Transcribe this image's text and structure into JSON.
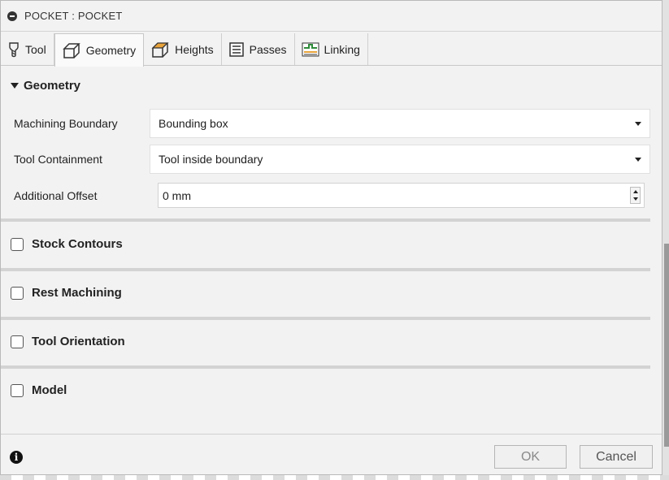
{
  "window": {
    "title": "POCKET : POCKET"
  },
  "tabs": [
    {
      "label": "Tool",
      "icon": "tool-icon",
      "active": false
    },
    {
      "label": "Geometry",
      "icon": "geometry-icon",
      "active": true
    },
    {
      "label": "Heights",
      "icon": "heights-icon",
      "active": false
    },
    {
      "label": "Passes",
      "icon": "passes-icon",
      "active": false
    },
    {
      "label": "Linking",
      "icon": "linking-icon",
      "active": false
    }
  ],
  "geometry": {
    "heading": "Geometry",
    "machining_boundary": {
      "label": "Machining Boundary",
      "value": "Bounding box"
    },
    "tool_containment": {
      "label": "Tool Containment",
      "value": "Tool inside boundary"
    },
    "additional_offset": {
      "label": "Additional Offset",
      "value": "0 mm"
    }
  },
  "groups": [
    {
      "label": "Stock Contours",
      "checked": false
    },
    {
      "label": "Rest Machining",
      "checked": false
    },
    {
      "label": "Tool Orientation",
      "checked": false
    },
    {
      "label": "Model",
      "checked": false
    }
  ],
  "footer": {
    "ok_label": "OK",
    "cancel_label": "Cancel",
    "info_glyph": "i"
  },
  "colors": {
    "dialog_bg": "#f2f2f2",
    "field_bg": "#ffffff",
    "divider": "#d3d3d3",
    "linking_accent": "#2e8b3a",
    "heights_accent": "#e8a33b"
  }
}
